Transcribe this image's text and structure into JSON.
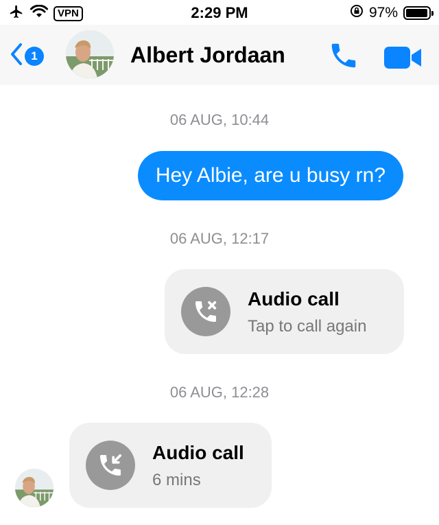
{
  "status_bar": {
    "vpn_label": "VPN",
    "time": "2:29 PM",
    "battery": "97%",
    "battery_level": 0.97,
    "icons": [
      "airplane-icon",
      "wifi-icon",
      "orientation-lock-icon",
      "battery-icon"
    ]
  },
  "header": {
    "back_badge": "1",
    "contact_name": "Albert Jordaan",
    "icons": [
      "back-chevron-icon",
      "phone-icon",
      "video-camera-icon"
    ],
    "accent_color": "#0a84ff"
  },
  "messages": {
    "stamp_1": "06 AUG, 10:44",
    "outgoing_text": "Hey Albie, are u busy rn?",
    "stamp_2": "06 AUG, 12:17",
    "call_1": {
      "title": "Audio call",
      "subtitle": "Tap to call again",
      "icon": "missed-call-icon"
    },
    "stamp_3": "06 AUG, 12:28",
    "call_2": {
      "title": "Audio call",
      "subtitle": "6 mins",
      "icon": "incoming-call-icon"
    }
  },
  "colors": {
    "outgoing_bubble": "#0a8cff",
    "call_card": "#f0f0f0",
    "call_icon_bg": "#999999",
    "timestamp": "#8e8e93"
  }
}
